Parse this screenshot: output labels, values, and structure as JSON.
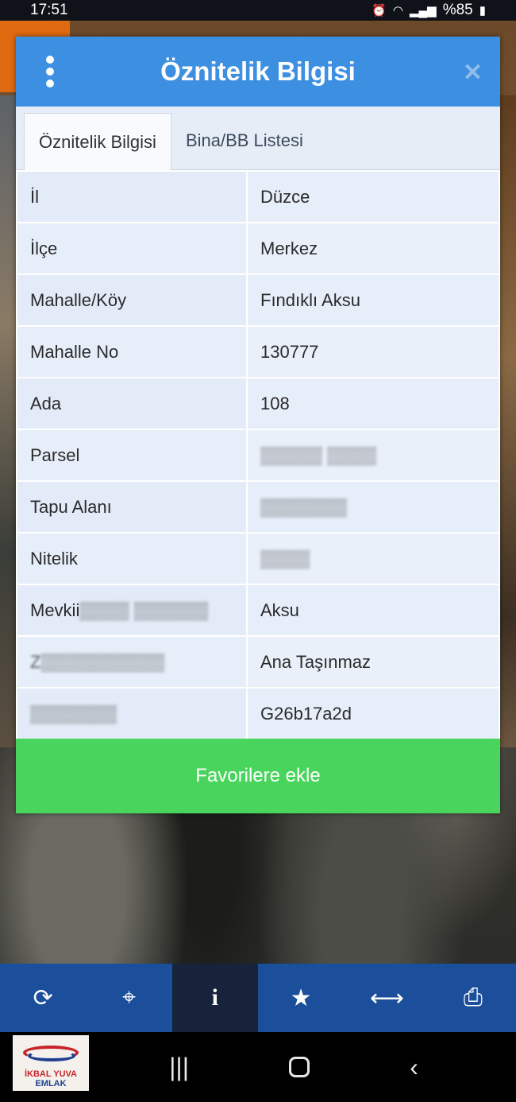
{
  "status_bar": {
    "time": "17:51",
    "battery": "%85"
  },
  "dialog": {
    "title": "Öznitelik Bilgisi",
    "tabs": [
      {
        "label": "Öznitelik Bilgisi",
        "active": true
      },
      {
        "label": "Bina/BB Listesi",
        "active": false
      }
    ],
    "rows": [
      {
        "key": "İl",
        "value": "Düzce"
      },
      {
        "key": "İlçe",
        "value": "Merkez"
      },
      {
        "key": "Mahalle/Köy",
        "value": "Fındıklı Aksu"
      },
      {
        "key": "Mahalle No",
        "value": "130777"
      },
      {
        "key": "Ada",
        "value": "108"
      },
      {
        "key": "Parsel",
        "value": ""
      },
      {
        "key": "Tapu Alanı",
        "value": ""
      },
      {
        "key": "Nitelik",
        "value": ""
      },
      {
        "key": "Mevkii",
        "value": "Aksu"
      },
      {
        "key": "",
        "value": "Ana Taşınmaz"
      },
      {
        "key": "",
        "value": "G26b17a2d"
      }
    ],
    "favorite_button": "Favorilere ekle"
  },
  "toolbar": {
    "items": [
      {
        "icon": "refresh-icon"
      },
      {
        "icon": "crosshair-icon"
      },
      {
        "icon": "info-icon",
        "active": true
      },
      {
        "icon": "star-icon"
      },
      {
        "icon": "measure-icon"
      },
      {
        "icon": "print-icon"
      }
    ]
  },
  "logo": {
    "line1": "İKBAL YUVA",
    "line2": "EMLAK"
  },
  "colors": {
    "header": "#3d8fe2",
    "favorite": "#49d45d",
    "toolbar": "#1b4e9b"
  }
}
